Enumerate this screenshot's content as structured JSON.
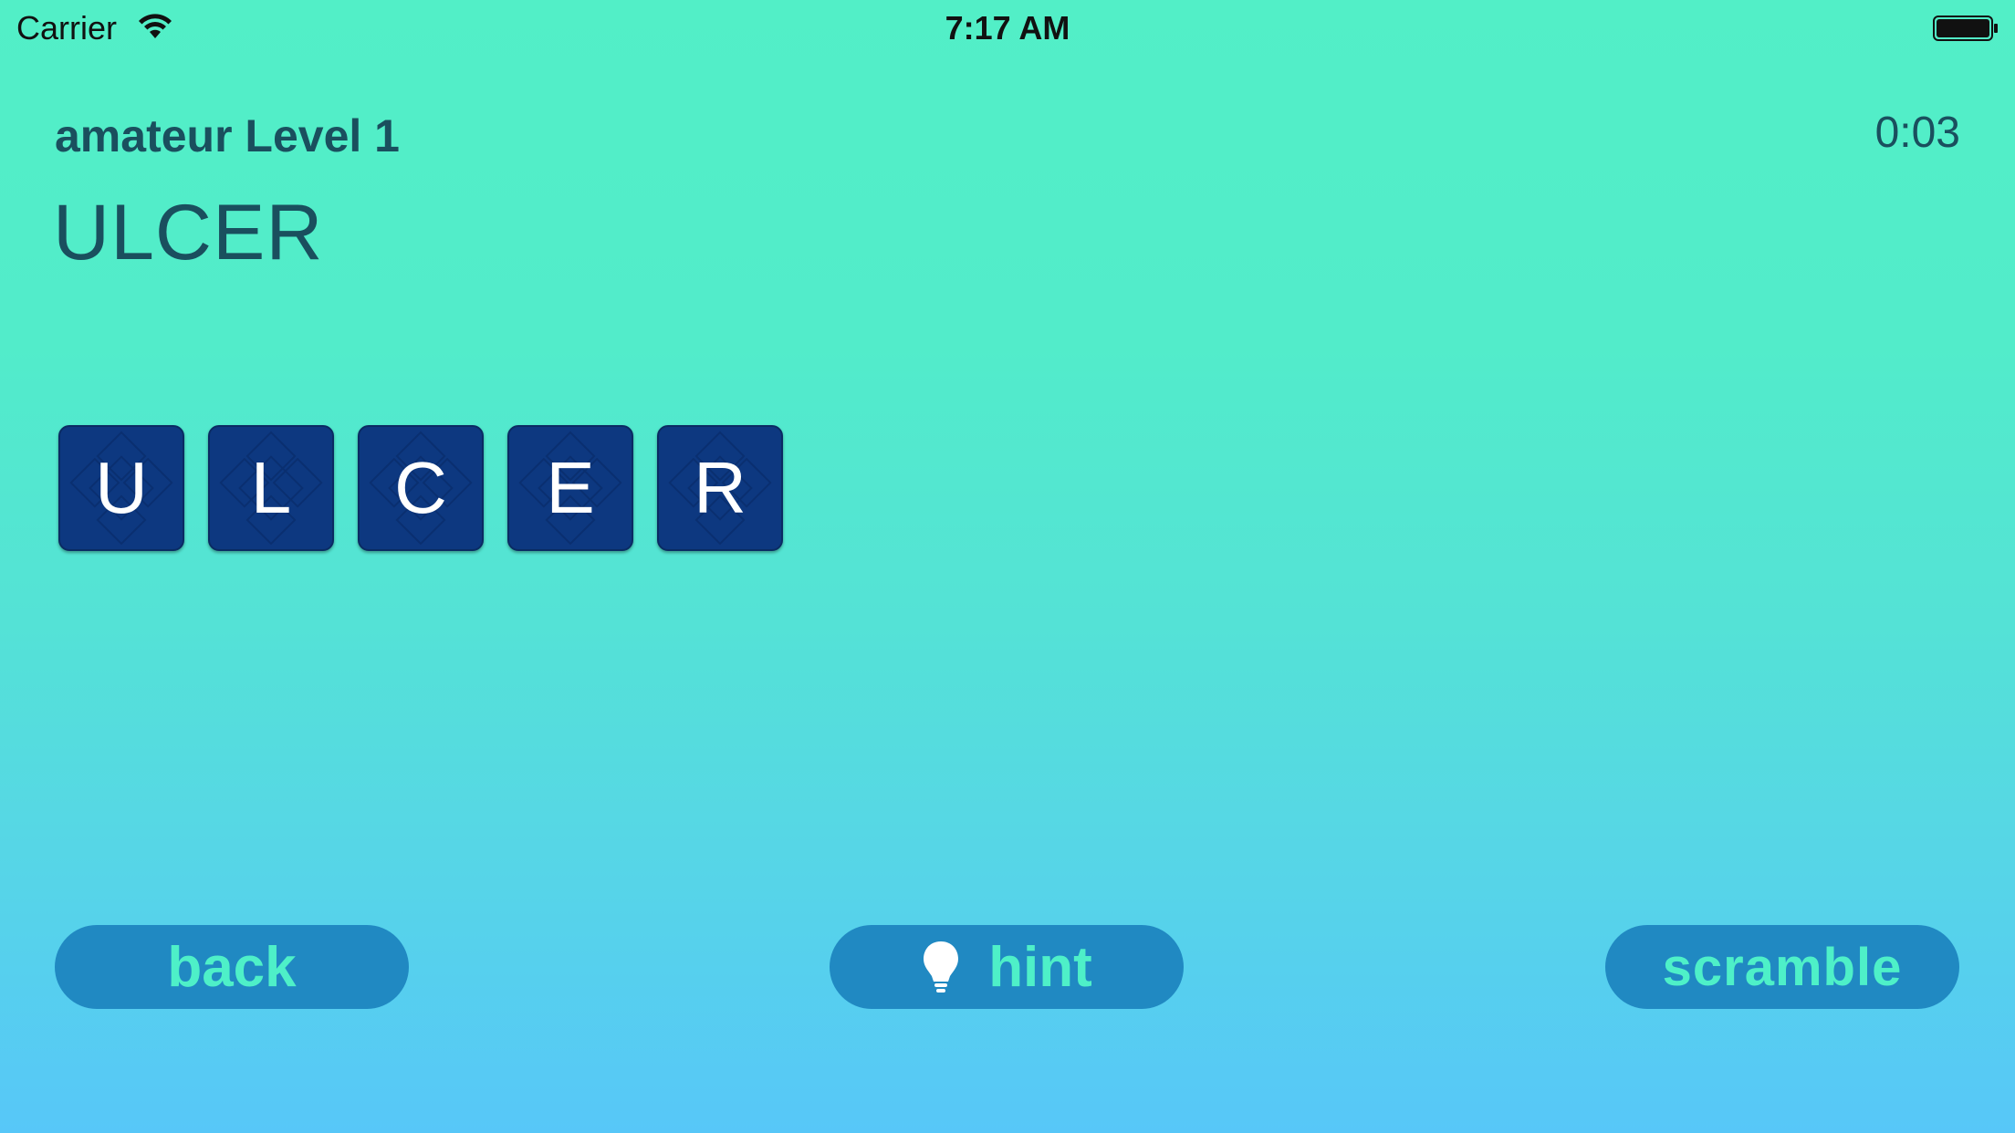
{
  "status_bar": {
    "carrier": "Carrier",
    "time": "7:17 AM",
    "icons": [
      "wifi-icon",
      "battery-icon"
    ]
  },
  "header": {
    "level_title": "amateur Level 1",
    "timer": "0:03",
    "word": "ULCER"
  },
  "tiles": [
    "U",
    "L",
    "C",
    "E",
    "R"
  ],
  "buttons": {
    "back": "back",
    "hint": "hint",
    "scramble": "scramble"
  },
  "colors": {
    "background_top": "#52efc7",
    "background_bottom": "#57c7f8",
    "tile": "#0d3880",
    "button": "#2089c2",
    "button_text": "#4ef0c8",
    "text": "#1a4f5e"
  }
}
